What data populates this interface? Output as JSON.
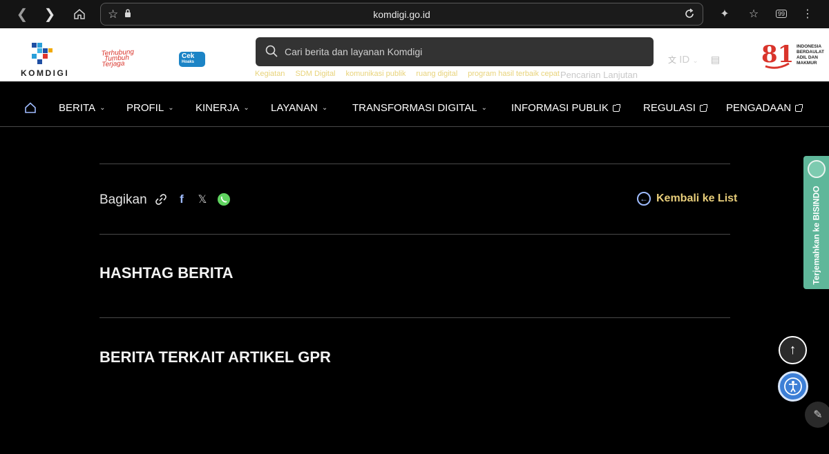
{
  "browser": {
    "url": "komdigi.go.id",
    "tab_count": "99"
  },
  "header": {
    "logo_text": "KOMDIGI",
    "tagline_lines": [
      "Terhubung",
      "Tumbuh",
      "Terjaga"
    ],
    "cek_hoaks_lines": [
      "Cek",
      "Hoaks"
    ],
    "search_placeholder": "Cari berita dan layanan Komdigi",
    "quick_links": [
      "Kegiatan",
      "SDM Digital",
      "komunikasi publik",
      "ruang digital",
      "program hasil terbaik cepat"
    ],
    "advanced_search": "Pencarian Lanjutan",
    "language": "ID",
    "emblem_lines": [
      "INDONESIA",
      "BERDAULAT",
      "ADIL DAN",
      "MAKMUR"
    ]
  },
  "nav": {
    "items": [
      {
        "label": "BERITA"
      },
      {
        "label": "PROFIL"
      },
      {
        "label": "KINERJA"
      },
      {
        "label": "LAYANAN"
      },
      {
        "label": "TRANSFORMASI DIGITAL"
      },
      {
        "label": "INFORMASI PUBLIK"
      },
      {
        "label": "REGULASI"
      },
      {
        "label": "PENGADAAN"
      }
    ]
  },
  "content": {
    "share_label": "Bagikan",
    "back_label": "Kembali ke List",
    "hashtag_heading": "HASHTAG BERITA",
    "related_heading": "BERITA TERKAIT ARTIKEL GPR"
  },
  "widgets": {
    "bisindo_label": "Terjemahkan ke BISINDO"
  },
  "colors": {
    "accent_gold": "#e7cd7a",
    "bisindo_green": "#5fb79a",
    "a11y_blue": "#3d7fd6"
  }
}
